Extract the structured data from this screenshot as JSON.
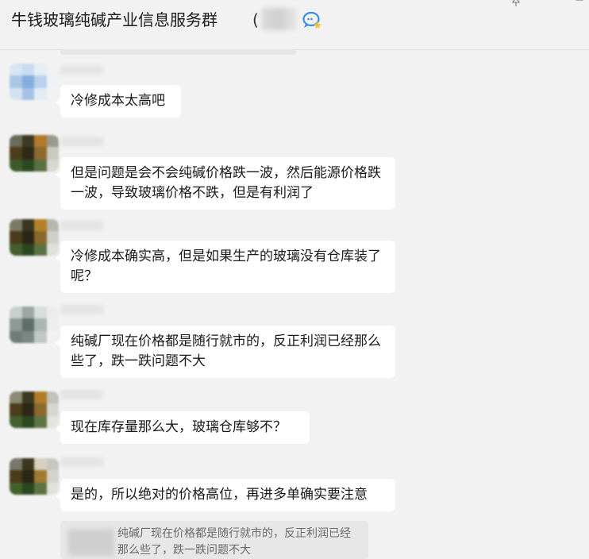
{
  "header": {
    "title": "牛钱玻璃纯碱产业信息服务群",
    "paren_open": "(",
    "icons": [
      "chat-bubble-icon",
      "pin-icon",
      "minimize-icon",
      "maximize-icon"
    ]
  },
  "messages": [
    {
      "text": "冷修成本太高吧"
    },
    {
      "text": "但是问题是会不会纯碱价格跌一波，然后能源价格跌一波，导致玻璃价格不跌，但是有利润了"
    },
    {
      "text": "冷修成本确实高，但是如果生产的玻璃没有仓库装了呢？"
    },
    {
      "text": "纯碱厂现在价格都是随行就市的，反正利润已经那么些了，跌一跌问题不大"
    },
    {
      "text": "现在库存量那么大，玻璃仓库够不？"
    },
    {
      "text": "是的，所以绝对的价格高位，再进多单确实要注意"
    }
  ],
  "quote": {
    "text": "纯碱厂现在价格都是随行就市的，反正利润已经那么些了，跌一跌问题不大"
  },
  "colors": {
    "background": "#f2f2f2",
    "bubble": "#ffffff",
    "quote_bg": "#e7e7e7",
    "accent_blue": "#3d8ee6"
  }
}
